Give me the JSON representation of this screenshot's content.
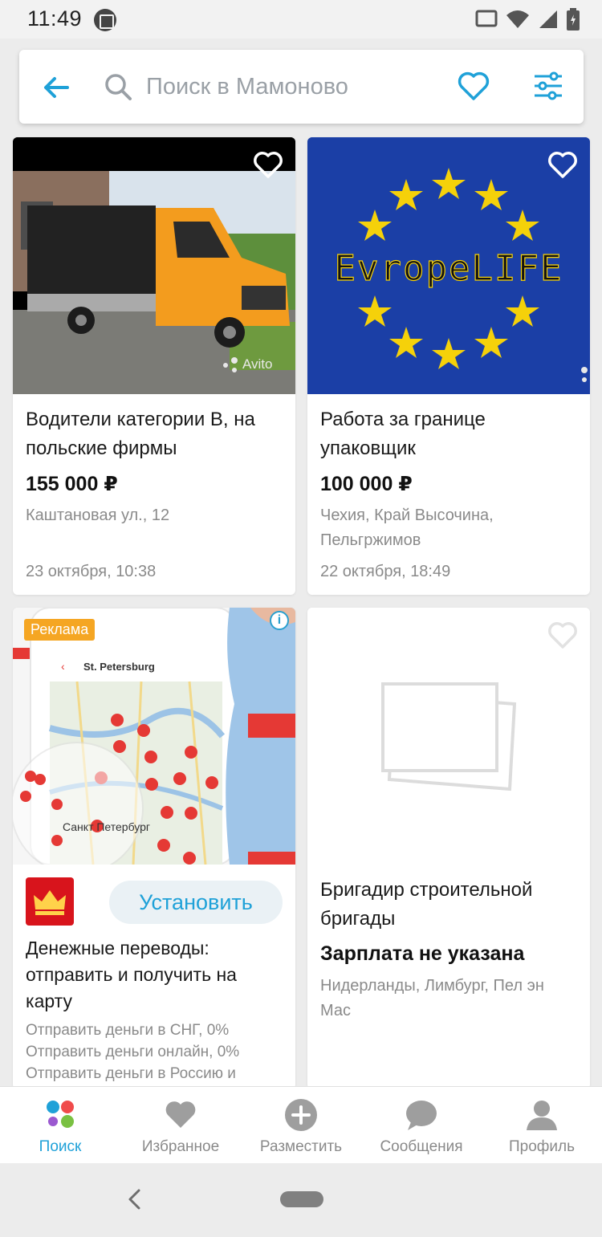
{
  "status_bar": {
    "time": "11:49"
  },
  "search": {
    "placeholder": "Поиск в Мамоново"
  },
  "listings": [
    {
      "title": "Водители категории В, на польские фирмы",
      "price": "155 000 ₽",
      "location": "Каштановая ул., 12",
      "date": "23 октября, 10:38",
      "watermark": "Avito"
    },
    {
      "title": "Работа за границе упаковщик",
      "price": "100 000 ₽",
      "location": "Чехия, Край Высочина, Пельгржимов",
      "date": "22 октября, 18:49",
      "image_text": "EvropeLIFE"
    },
    {
      "title": "Бригадир строительной бригады",
      "price": "Зарплата не указана",
      "location": "Нидерланды, Лимбург, Пел эн Мас"
    }
  ],
  "ad": {
    "badge": "Реклама",
    "map_city": "St. Petersburg",
    "map_city_ru": "Санкт Петербург",
    "install_label": "Установить",
    "title": "Денежные переводы: отправить и получить на карту",
    "lines": [
      "Отправить деньги в СНГ, 0%",
      "Отправить деньги онлайн, 0%",
      "Отправить деньги в Россию и"
    ]
  },
  "bottom_nav": [
    {
      "label": "Поиск",
      "icon": "search-dots-icon",
      "active": true
    },
    {
      "label": "Избранное",
      "icon": "heart-icon",
      "active": false
    },
    {
      "label": "Разместить",
      "icon": "plus-circle-icon",
      "active": false
    },
    {
      "label": "Сообщения",
      "icon": "chat-bubble-icon",
      "active": false
    },
    {
      "label": "Профиль",
      "icon": "person-icon",
      "active": false
    }
  ],
  "colors": {
    "accent": "#1fa1d8",
    "ad_badge": "#f5a623",
    "eu_blue": "#1b3fa6",
    "eu_star": "#f5d10a"
  }
}
